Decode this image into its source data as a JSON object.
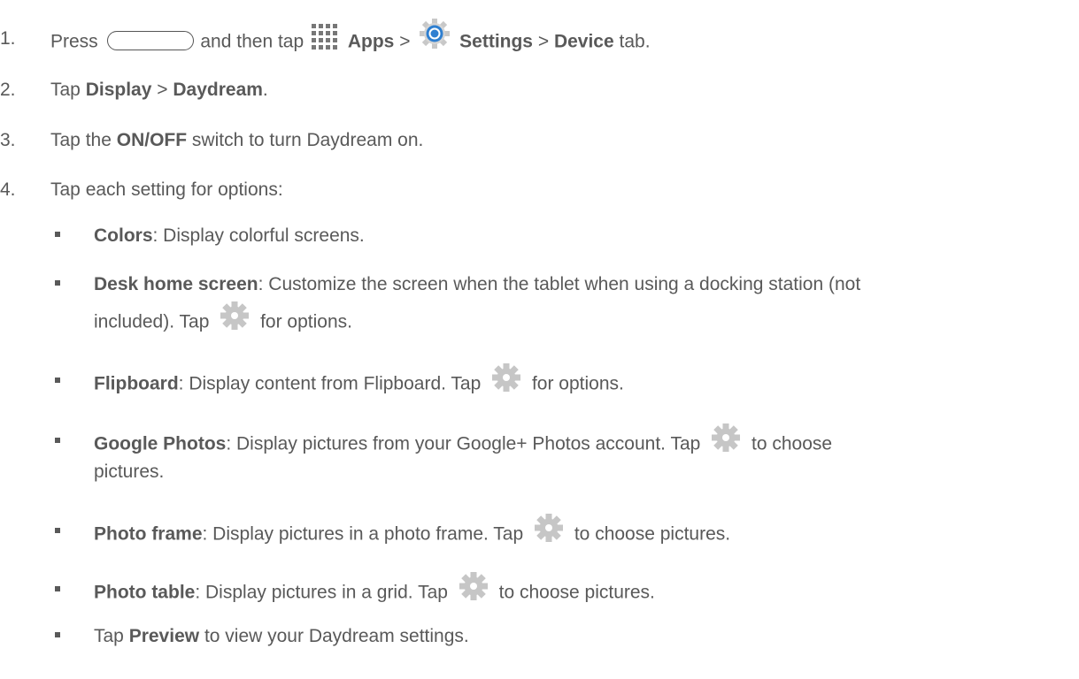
{
  "colors": {
    "text": "#595959",
    "gear": "#c6c6c6",
    "settings_blue": "#2f7fd0",
    "apps_grid": "#777777"
  },
  "icons": {
    "home_key": "home-key-icon",
    "apps": "apps-grid-icon",
    "settings": "settings-gear-icon",
    "gear": "gear-icon"
  },
  "steps": [
    {
      "num": "1.",
      "t1": "Press",
      "t2": "and then tap",
      "b1": "Apps",
      "t3": ">",
      "b2": "Settings",
      "t4": ">",
      "b3": "Device",
      "t5": "tab."
    },
    {
      "num": "2.",
      "t1": "Tap",
      "b1": "Display",
      "t2": ">",
      "b2": "Daydream",
      "t3": "."
    },
    {
      "num": "3.",
      "t1": "Tap the",
      "b1": "ON/OFF",
      "t2": "switch to turn Daydream on."
    },
    {
      "num": "4.",
      "t1": "Tap each setting for options:"
    }
  ],
  "options": [
    {
      "name": "Colors",
      "desc": ": Display colorful screens."
    },
    {
      "name": "Desk home screen",
      "desc": ": Customize the screen when the tablet when using a docking station (not",
      "desc2a": "included). Tap",
      "desc2b": "for  options."
    },
    {
      "name": "Flipboard",
      "desc": ": Display content from Flipboard. Tap",
      "desc_after": "for  options."
    },
    {
      "name": "Google Photos",
      "desc": ": Display pictures from your Google+ Photos account. Tap",
      "desc_after": "to choose",
      "desc2": "pictures."
    },
    {
      "name": "Photo frame",
      "desc": ": Display pictures in a photo frame. Tap",
      "desc_after": "to choose pictures."
    },
    {
      "name": "Photo table",
      "desc": ": Display pictures in a grid. Tap",
      "desc_after": "to choose pictures."
    },
    {
      "pre": "Tap",
      "name": "Preview",
      "desc": "to view your Daydream settings."
    }
  ]
}
